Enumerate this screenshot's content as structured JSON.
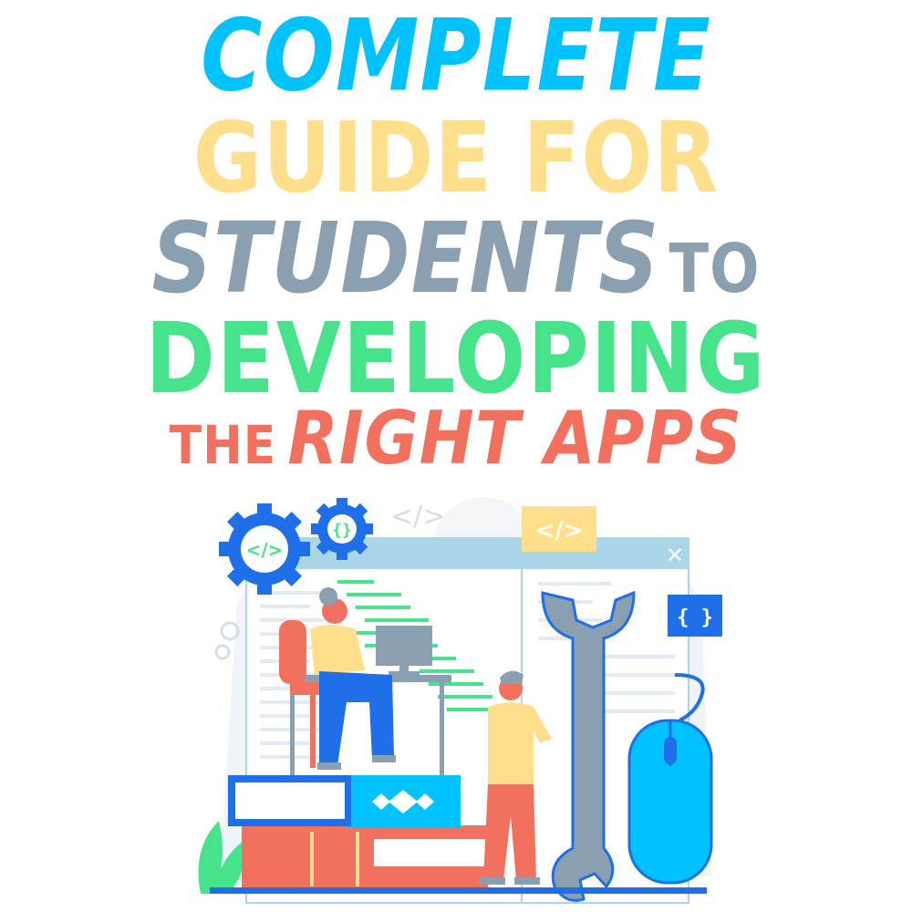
{
  "title": {
    "line1": "COMPLETE",
    "line2": "GUIDE FOR",
    "line3_main": "STUDENTS",
    "line3_small": "TO",
    "line4": "DEVELOPING",
    "line5_small": "THE",
    "line5_main": "RIGHT APPS"
  },
  "illustration": {
    "code_badge_top": "</>",
    "code_tag_faint": "</>",
    "code_gear_large": "</>",
    "brace_gear_small": "{}",
    "brace_badge_right": "{ }",
    "close_glyph": "✕"
  },
  "colors": {
    "cyan": "#00C2FF",
    "yellow": "#FFDF8C",
    "slate": "#8A9FB0",
    "green": "#47E38B",
    "coral": "#F2705E",
    "blue": "#1E6FE8"
  }
}
